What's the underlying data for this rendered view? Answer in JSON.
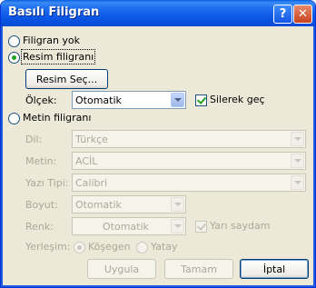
{
  "window": {
    "title": "Basılı Filigran",
    "help_label": "?",
    "close_label": "✕"
  },
  "options": {
    "no_watermark": "Filigran yok",
    "picture_watermark": "Resim filigranı",
    "text_watermark": "Metin filigranı",
    "selected": "picture_watermark"
  },
  "picture": {
    "select_button": "Resim Seç...",
    "scale_label": "Ölçek:",
    "scale_value": "Otomatik",
    "washout_label": "Silerek geç",
    "washout_checked": true
  },
  "text": {
    "language_label": "Dil:",
    "language_value": "Türkçe",
    "text_label": "Metin:",
    "text_value": "ACİL",
    "font_label": "Yazı Tipi:",
    "font_value": "Calibri",
    "size_label": "Boyut:",
    "size_value": "Otomatik",
    "color_label": "Renk:",
    "color_value": "Otomatik",
    "semitransparent_label": "Yarı saydam",
    "semitransparent_checked": true,
    "layout_label": "Yerleşim:",
    "diagonal_label": "Köşegen",
    "horizontal_label": "Yatay",
    "layout_selected": "diagonal"
  },
  "footer": {
    "apply": "Uygula",
    "ok": "Tamam",
    "cancel": "İptal"
  }
}
